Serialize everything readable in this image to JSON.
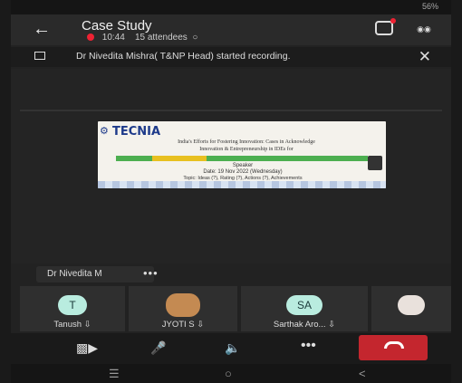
{
  "status": {
    "battery": "56%"
  },
  "header": {
    "title": "Case Study",
    "time": "10:44",
    "attendees": "15 attendees"
  },
  "banner": {
    "message": "Dr Nivedita Mishra( T&NP Head) started recording."
  },
  "slide": {
    "logo": "TECNIA",
    "line1": "India's Efforts for Fostering Innovation: Cases in Acknowledge",
    "line2": "Innovation & Entrepreneurship in IDEs for",
    "line3": "Speaker",
    "line4": "Date: 19 Nov 2022 (Wednesday)",
    "line5": "Topic: Ideas (?), Rating (?), Actions (?), Achievements"
  },
  "presenter": {
    "name": "Dr Nivedita M",
    "more": "•••"
  },
  "participants": [
    {
      "initials": "T",
      "name": "Tanush",
      "color": "#b9ecdf"
    },
    {
      "initials": "",
      "name": "JYOTI S",
      "color": "#c48a52"
    },
    {
      "initials": "SA",
      "name": "Sarthak Aro...",
      "color": "#b9ecdf"
    },
    {
      "initials": "",
      "name": "",
      "color": "#e9e1dc"
    }
  ],
  "controls": {
    "camera_icon": "camera-off-icon",
    "mic_icon": "mic-off-icon",
    "speaker_icon": "speaker-icon",
    "more_label": "•••",
    "end_icon": "hang-up-icon"
  }
}
